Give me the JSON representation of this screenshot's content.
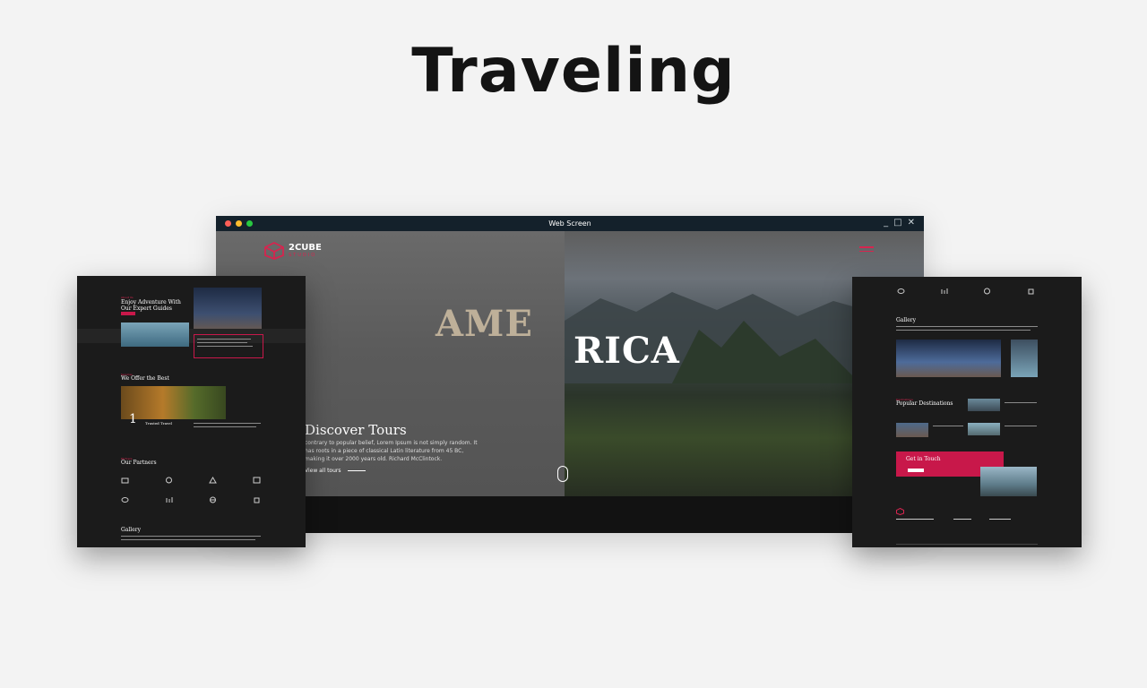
{
  "page_title": "Traveling",
  "window": {
    "title": "Web Screen",
    "controls": [
      "_",
      "□",
      "✕"
    ],
    "dot_colors": [
      "#ff5f57",
      "#febc2e",
      "#28c840"
    ]
  },
  "brand": {
    "name": "2CUBE",
    "tagline": "STUDIO",
    "accent": "#d6254f"
  },
  "hero": {
    "word_left": "AME",
    "word_right": "RICA",
    "heading": "Discover Tours",
    "text": "contrary to popular belief, Lorem Ipsum is not simply random. It has roots in a piece of classical Latin literature from 45 BC, making it over 2000 years old. Richard McClintock.",
    "link": "View all tours"
  },
  "left_panel": {
    "adventure_tag": "About Us",
    "adventure_title": "Enjoy Adventure With Our Expert Guides",
    "offer_tag": "Services",
    "offer_title": "We Offer the Best",
    "stat_number": "1",
    "stat_label": "Trusted Travel",
    "partners_tag": "Partners",
    "partners_title": "Our Partners",
    "gallery_title": "Gallery"
  },
  "right_panel": {
    "gallery_title": "Gallery",
    "dest_tag": "Destinations",
    "dest_title": "Popular Destinations",
    "cta": "Get in Touch"
  }
}
